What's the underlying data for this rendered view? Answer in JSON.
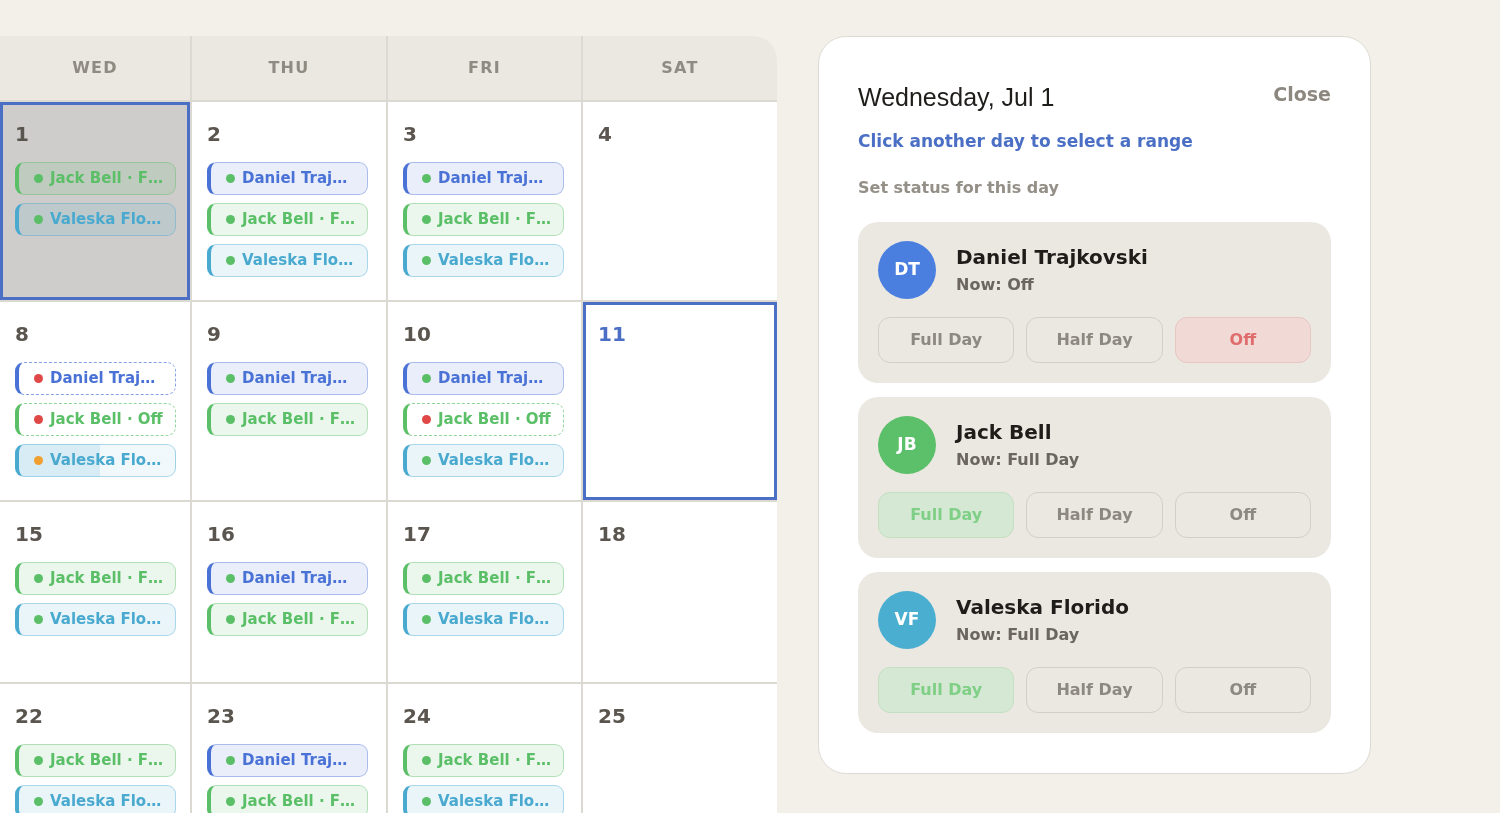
{
  "calendar": {
    "weekdays": [
      "WED",
      "THU",
      "FRI",
      "SAT"
    ],
    "weeks": [
      {
        "days": [
          {
            "number": "1",
            "selected": true,
            "today": false,
            "entries": [
              {
                "label": "Jack Bell · F…",
                "color": "#5bbf68",
                "kind": "full"
              },
              {
                "label": "Valeska Flo…",
                "color": "#49a9cf",
                "kind": "full"
              }
            ]
          },
          {
            "number": "2",
            "selected": false,
            "today": false,
            "entries": [
              {
                "label": "Daniel Traj…",
                "color": "#4a72d6",
                "kind": "full"
              },
              {
                "label": "Jack Bell · F…",
                "color": "#5bbf68",
                "kind": "full"
              },
              {
                "label": "Valeska Flo…",
                "color": "#49a9cf",
                "kind": "full"
              }
            ]
          },
          {
            "number": "3",
            "selected": false,
            "today": false,
            "entries": [
              {
                "label": "Daniel Traj…",
                "color": "#4a72d6",
                "kind": "full"
              },
              {
                "label": "Jack Bell · F…",
                "color": "#5bbf68",
                "kind": "full"
              },
              {
                "label": "Valeska Flo…",
                "color": "#49a9cf",
                "kind": "full"
              }
            ]
          },
          {
            "number": "4",
            "selected": false,
            "today": false
          }
        ]
      },
      {
        "days": [
          {
            "number": "8",
            "selected": false,
            "today": false,
            "entries": [
              {
                "label": "Daniel Traj…",
                "color": "#4a72d6",
                "kind": "off"
              },
              {
                "label": "Jack Bell · Off",
                "color": "#5bbf68",
                "kind": "off"
              },
              {
                "label": "Valeska Flo…",
                "color": "#49a9cf",
                "kind": "half"
              }
            ]
          },
          {
            "number": "9",
            "selected": false,
            "today": false,
            "entries": [
              {
                "label": "Daniel Traj…",
                "color": "#4a72d6",
                "kind": "full"
              },
              {
                "label": "Jack Bell · F…",
                "color": "#5bbf68",
                "kind": "full"
              }
            ]
          },
          {
            "number": "10",
            "selected": false,
            "today": false,
            "entries": [
              {
                "label": "Daniel Traj…",
                "color": "#4a72d6",
                "kind": "full"
              },
              {
                "label": "Jack Bell · Off",
                "color": "#5bbf68",
                "kind": "off"
              },
              {
                "label": "Valeska Flo…",
                "color": "#49a9cf",
                "kind": "full"
              }
            ]
          },
          {
            "number": "11",
            "selected": false,
            "today": true
          }
        ]
      },
      {
        "days": [
          {
            "number": "15",
            "selected": false,
            "today": false,
            "entries": [
              {
                "label": "Jack Bell · F…",
                "color": "#5bbf68",
                "kind": "full"
              },
              {
                "label": "Valeska Flo…",
                "color": "#49a9cf",
                "kind": "full"
              }
            ]
          },
          {
            "number": "16",
            "selected": false,
            "today": false,
            "entries": [
              {
                "label": "Daniel Traj…",
                "color": "#4a72d6",
                "kind": "full"
              },
              {
                "label": "Jack Bell · F…",
                "color": "#5bbf68",
                "kind": "full"
              }
            ]
          },
          {
            "number": "17",
            "selected": false,
            "today": false,
            "entries": [
              {
                "label": "Jack Bell · F…",
                "color": "#5bbf68",
                "kind": "full"
              },
              {
                "label": "Valeska Flo…",
                "color": "#49a9cf",
                "kind": "full"
              }
            ]
          },
          {
            "number": "18",
            "selected": false,
            "today": false
          }
        ]
      },
      {
        "days": [
          {
            "number": "22",
            "selected": false,
            "today": false,
            "entries": [
              {
                "label": "Jack Bell · F…",
                "color": "#5bbf68",
                "kind": "full"
              },
              {
                "label": "Valeska Flo…",
                "color": "#49a9cf",
                "kind": "full"
              }
            ]
          },
          {
            "number": "23",
            "selected": false,
            "today": false,
            "entries": [
              {
                "label": "Daniel Traj…",
                "color": "#4a72d6",
                "kind": "full"
              },
              {
                "label": "Jack Bell · F…",
                "color": "#5bbf68",
                "kind": "full"
              }
            ]
          },
          {
            "number": "24",
            "selected": false,
            "today": false,
            "entries": [
              {
                "label": "Jack Bell · F…",
                "color": "#5bbf68",
                "kind": "full"
              },
              {
                "label": "Valeska Flo…",
                "color": "#49a9cf",
                "kind": "full"
              }
            ]
          },
          {
            "number": "25",
            "selected": false,
            "today": false
          }
        ]
      }
    ]
  },
  "day_panel": {
    "title": "Wednesday, Jul 1",
    "close_label": "Close",
    "hint": "Click another day to select a range",
    "section_label": "Set status for this day",
    "people": [
      {
        "initials": "DT",
        "name": "Daniel Trajkovski",
        "color": "#4a7fe0",
        "current_status": "Now: Off",
        "options": [
          {
            "label": "Full Day",
            "kind": "full",
            "selected": false
          },
          {
            "label": "Half Day",
            "kind": "half",
            "selected": false
          },
          {
            "label": "Off",
            "kind": "off",
            "selected": true
          }
        ]
      },
      {
        "initials": "JB",
        "name": "Jack Bell",
        "color": "#5cbf6a",
        "current_status": "Now: Full Day",
        "options": [
          {
            "label": "Full Day",
            "kind": "full",
            "selected": true
          },
          {
            "label": "Half Day",
            "kind": "half",
            "selected": false
          },
          {
            "label": "Off",
            "kind": "off",
            "selected": false
          }
        ]
      },
      {
        "initials": "VF",
        "name": "Valeska Florido",
        "color": "#4aaed0",
        "current_status": "Now: Full Day",
        "options": [
          {
            "label": "Full Day",
            "kind": "full",
            "selected": true
          },
          {
            "label": "Half Day",
            "kind": "half",
            "selected": false
          },
          {
            "label": "Off",
            "kind": "off",
            "selected": false
          }
        ]
      }
    ]
  }
}
